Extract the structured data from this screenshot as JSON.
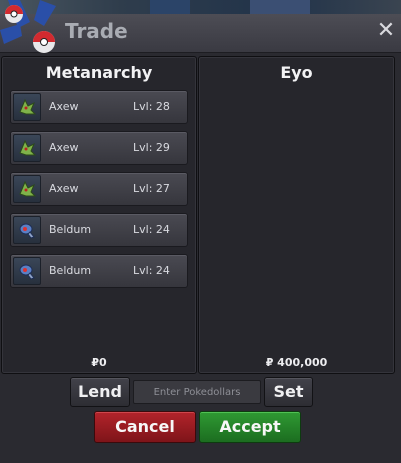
{
  "window": {
    "title": "Trade",
    "close_label": "✕"
  },
  "left_panel": {
    "player_name": "Metanarchy",
    "money": "₽0",
    "pokemon": [
      {
        "name": "Axew",
        "level": "Lvl: 28",
        "icon": "axew-icon"
      },
      {
        "name": "Axew",
        "level": "Lvl: 29",
        "icon": "axew-icon"
      },
      {
        "name": "Axew",
        "level": "Lvl: 27",
        "icon": "axew-icon"
      },
      {
        "name": "Beldum",
        "level": "Lvl: 24",
        "icon": "beldum-icon"
      },
      {
        "name": "Beldum",
        "level": "Lvl: 24",
        "icon": "beldum-icon"
      }
    ]
  },
  "right_panel": {
    "player_name": "Eyo",
    "money": "₽ 400,000"
  },
  "money_controls": {
    "lend_label": "Lend",
    "input_placeholder": "Enter Pokedollars",
    "set_label": "Set"
  },
  "actions": {
    "cancel_label": "Cancel",
    "accept_label": "Accept"
  },
  "colors": {
    "accent_cancel": "#a21f26",
    "accent_accept": "#29882d",
    "panel_bg": "#26262c"
  }
}
